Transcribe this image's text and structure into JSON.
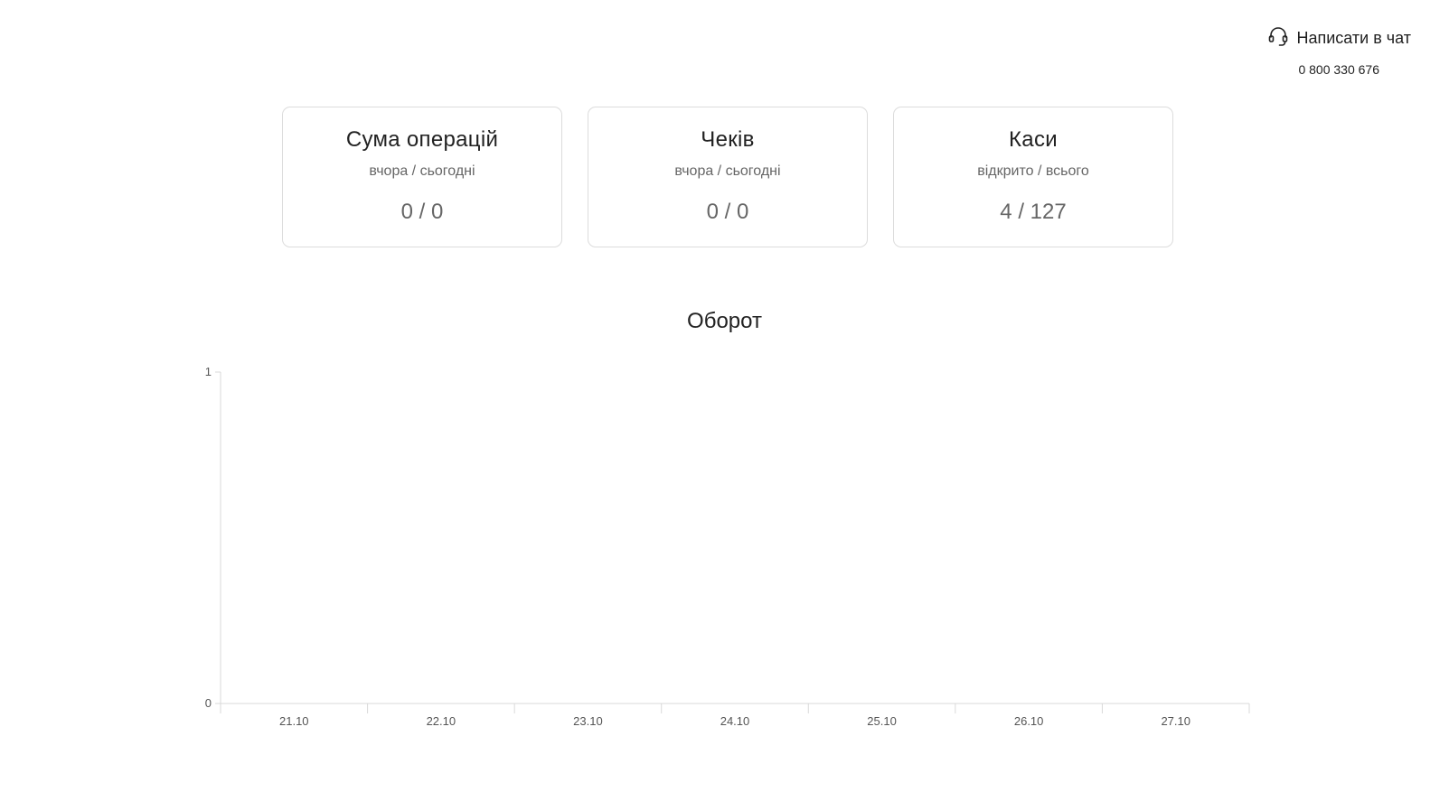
{
  "support": {
    "chat_label": "Написати в чат",
    "phone": "0 800 330 676"
  },
  "cards": [
    {
      "title": "Сума операцій",
      "subtitle": "вчора / сьогодні",
      "value": "0 / 0"
    },
    {
      "title": "Чеків",
      "subtitle": "вчора / сьогодні",
      "value": "0 / 0"
    },
    {
      "title": "Каси",
      "subtitle": "відкрито / всього",
      "value": "4 / 127"
    }
  ],
  "chart_data": {
    "type": "line",
    "title": "Оборот",
    "categories": [
      "21.10",
      "22.10",
      "23.10",
      "24.10",
      "25.10",
      "26.10",
      "27.10"
    ],
    "ylim": [
      0,
      1
    ],
    "yticks": [
      "0",
      "1"
    ],
    "series": [],
    "grid": false,
    "axis_color": "#d9d9d9"
  }
}
